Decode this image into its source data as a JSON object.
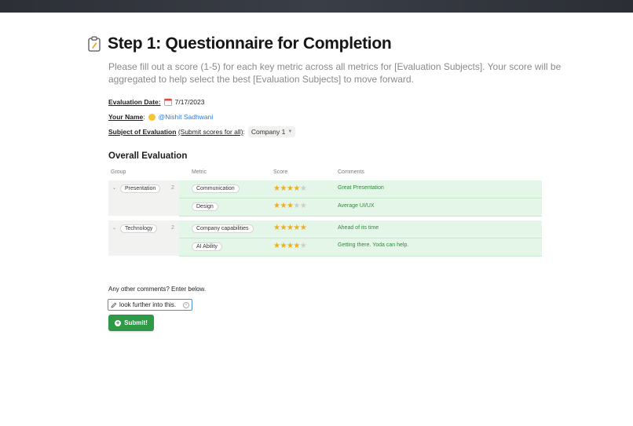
{
  "header": {
    "title": "Step 1: Questionnaire for Completion",
    "description": "Please fill out a score (1-5) for each key metric across all metrics for [Evaluation Subjects]. Your score will be aggregated to help select the best [Evaluation Subjects] to move forward."
  },
  "meta": {
    "date_label": "Evaluation Date:",
    "date_value": "7/17/2023",
    "name_label": "Your Name",
    "name_sep": ":",
    "name_value": "@Nishit Sadhwani",
    "subject_label": "Subject of Evaluation",
    "subject_hint": "(Submit scores for all)",
    "subject_sep": ":",
    "subject_value": "Company 1"
  },
  "evaluation": {
    "section_title": "Overall Evaluation",
    "columns": [
      "Group",
      "Metric",
      "Score",
      "Comments"
    ],
    "groups": [
      {
        "name": "Presentation",
        "count": "2",
        "rows": [
          {
            "metric": "Communication",
            "score": 4,
            "comment": "Great Presentation"
          },
          {
            "metric": "Design",
            "score": 3,
            "comment": "Average UI/UX"
          }
        ]
      },
      {
        "name": "Technology",
        "count": "2",
        "rows": [
          {
            "metric": "Company capabilities",
            "score": 5,
            "comment": "Ahead of its time"
          },
          {
            "metric": "AI Ability",
            "score": 4,
            "comment": "Getting there. Yoda can help."
          }
        ]
      }
    ]
  },
  "feedback": {
    "label": "Any other comments? Enter below.",
    "value": "look further into this.",
    "submit_label": "Submit!"
  },
  "colors": {
    "accent_green": "#2e9a47",
    "row_green": "#e4f6e7",
    "star": "#f2ac1a",
    "mention": "#2c7be5"
  },
  "icons": [
    "clipboard-icon",
    "calendar-icon",
    "smile-emoji-icon",
    "chevron-down-icon",
    "pencil-icon",
    "clear-icon",
    "plus-circle-icon",
    "star-icon"
  ]
}
